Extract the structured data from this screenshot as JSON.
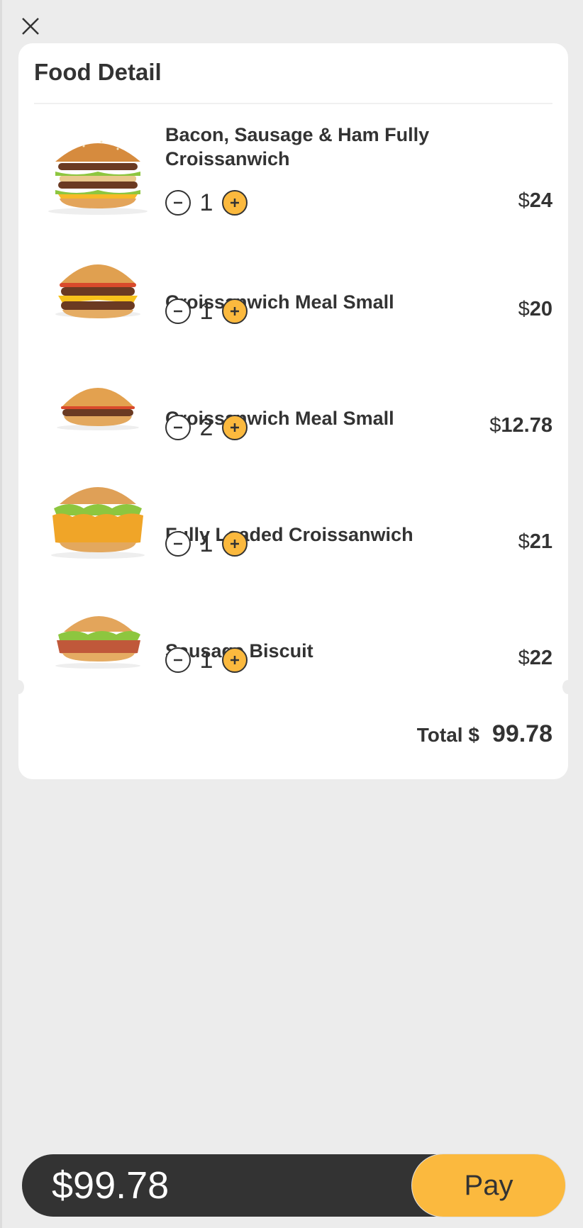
{
  "icons": {
    "close": "close-icon",
    "minus": "minus-circle-icon",
    "plus": "plus-circle-icon"
  },
  "colors": {
    "accent": "#fbb93e",
    "dark": "#333333",
    "background": "#ececec",
    "card": "#ffffff"
  },
  "card": {
    "title": "Food Detail"
  },
  "items": [
    {
      "name": "Bacon, Sausage & Ham Fully Croissanwich",
      "qty": "1",
      "currency": "$",
      "price": "24",
      "image": "big-mac-burger"
    },
    {
      "name": "Croissanwich Meal Small",
      "qty": "1",
      "currency": "$",
      "price": "20",
      "image": "double-cheeseburger"
    },
    {
      "name": "Croissanwich Meal Small",
      "qty": "2",
      "currency": "$",
      "price": "12.78",
      "image": "hamburger"
    },
    {
      "name": "Fully Loaded Croissanwich",
      "qty": "1",
      "currency": "$",
      "price": "21",
      "image": "crispy-chicken-burger"
    },
    {
      "name": "Sausage Biscuit",
      "qty": "1",
      "currency": "$",
      "price": "22",
      "image": "sausage-burger"
    }
  ],
  "total": {
    "label": "Total $",
    "value": "99.78"
  },
  "bottom_bar": {
    "amount": "$99.78",
    "pay_label": "Pay"
  }
}
